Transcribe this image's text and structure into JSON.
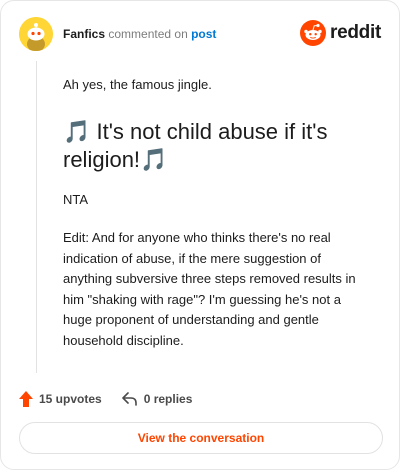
{
  "comment": {
    "username": "Fanfics",
    "verb": "commented on",
    "post_link": "post",
    "intro": "Ah yes, the famous jingle.",
    "big_text": "🎵 It's not child abuse if it's religion!🎵",
    "nta": "NTA",
    "edit": "Edit: And for anyone who thinks there's no real indication of abuse, if the mere suggestion of anything subversive three steps removed results in him \"shaking with rage\"? I'm guessing he's not a huge proponent of understanding and gentle household discipline."
  },
  "brand": {
    "logo_text": "reddit",
    "color": "#ff4500"
  },
  "stats": {
    "upvotes": "15 upvotes",
    "replies": "0 replies"
  },
  "cta": {
    "label": "View the conversation"
  },
  "colors": {
    "avatar_bg": "#ffd635",
    "accent": "#ff4500",
    "link": "#0079d3"
  },
  "icons": [
    "avatar-icon",
    "reddit-logo-icon",
    "upvote-arrow-icon",
    "reply-icon"
  ]
}
